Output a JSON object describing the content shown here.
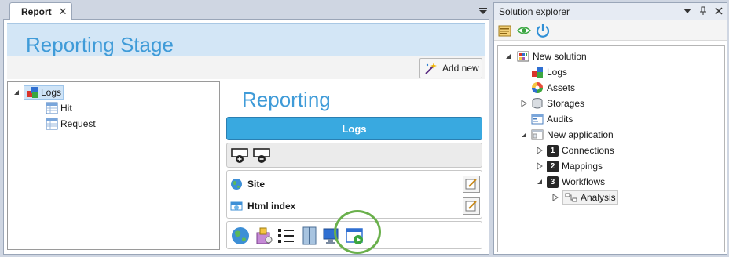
{
  "document_tab": {
    "label": "Report",
    "close_glyph": "✕"
  },
  "stage": {
    "title": "Reporting Stage",
    "add_new_label": "Add new"
  },
  "left_tree": {
    "root": {
      "label": "Logs",
      "expanded": true,
      "icon": "logs-icon"
    },
    "children": [
      {
        "label": "Hit",
        "icon": "table-icon"
      },
      {
        "label": "Request",
        "icon": "table-icon"
      }
    ]
  },
  "reporting": {
    "title": "Reporting",
    "logs_button": "Logs",
    "items": [
      {
        "label": "Site",
        "icon": "globe-icon"
      },
      {
        "label": "Html index",
        "icon": "html-index-icon"
      }
    ],
    "toolbar_icons": [
      "globe-icon",
      "package-icon",
      "list-icon",
      "zip-icon",
      "computer-icon",
      "run-window-icon"
    ]
  },
  "solution_explorer": {
    "title": "Solution explorer",
    "tree": {
      "root": "New solution",
      "solution_items": [
        "Logs",
        "Assets",
        "Storages",
        "Audits"
      ],
      "application": "New application",
      "app_items": [
        {
          "number": "1",
          "label": "Connections"
        },
        {
          "number": "2",
          "label": "Mappings"
        },
        {
          "number": "3",
          "label": "Workflows"
        }
      ],
      "workflow_child": "Analysis"
    }
  },
  "colors": {
    "accent": "#3f9bd8",
    "logs_button": "#39a9e0",
    "highlight_ring": "#6ab04c"
  }
}
